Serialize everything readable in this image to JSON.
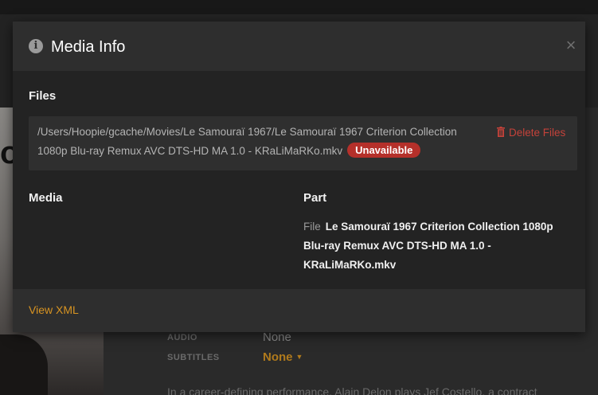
{
  "background": {
    "audio_label": "AUDIO",
    "audio_value": "None",
    "subtitles_label": "SUBTITLES",
    "subtitles_value": "None",
    "description": "In a career-defining performance, Alain Delon plays Jef Costello, a contract"
  },
  "modal": {
    "title": "Media Info",
    "close_symbol": "×",
    "files_heading": "Files",
    "file_path_line1": "/Users/Hoopie/gcache/Movies/Le Samouraï 1967/Le Samouraï 1967 Criterion Collection",
    "file_path_line2": "1080p Blu-ray Remux AVC DTS-HD MA 1.0 - KRaLiMaRKo.mkv",
    "status_badge": "Unavailable",
    "delete_label": "Delete Files",
    "media_heading": "Media",
    "part_heading": "Part",
    "part_file_label": "File",
    "part_file_value": "Le Samouraï 1967 Criterion Collection 1080p Blu-ray Remux AVC DTS-HD MA 1.0 - KRaLiMaRKo.mkv",
    "view_xml_label": "View XML"
  },
  "colors": {
    "accent": "#d89422",
    "danger": "#c4423a",
    "badge": "#b5302a"
  },
  "icons": {
    "info": "info-icon",
    "close": "close-icon",
    "trash": "trash-icon",
    "caret": "caret-down-icon"
  }
}
